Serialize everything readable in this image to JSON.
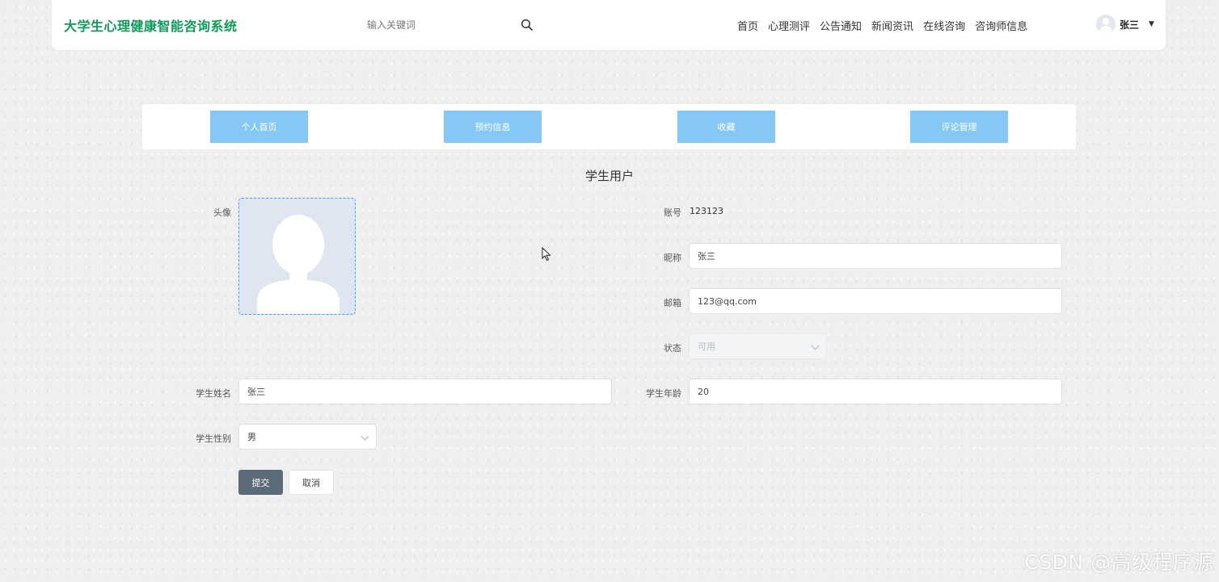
{
  "header": {
    "site_title": "大学生心理健康智能咨询系统",
    "search_placeholder": "输入关键词",
    "nav": [
      "首页",
      "心理测评",
      "公告通知",
      "新闻资讯",
      "在线咨询",
      "咨询师信息"
    ],
    "user_name": "张三"
  },
  "tabs": [
    "个人首页",
    "预约信息",
    "收藏",
    "评论管理"
  ],
  "form": {
    "title": "学生用户",
    "avatar_label": "头像",
    "account_label": "账号",
    "account_value": "123123",
    "nickname_label": "昵称",
    "nickname_value": "张三",
    "email_label": "邮箱",
    "email_value": "123@qq.com",
    "status_label": "状态",
    "status_value": "可用",
    "name_label": "学生姓名",
    "name_value": "张三",
    "age_label": "学生年龄",
    "age_value": "20",
    "gender_label": "学生性别",
    "gender_value": "男",
    "submit_label": "提交",
    "cancel_label": "取消"
  },
  "watermark": "CSDN @高级程序源",
  "colors": {
    "brand": "#0e9b5a",
    "tab": "#86c8f5",
    "submit": "#5b6b78"
  }
}
